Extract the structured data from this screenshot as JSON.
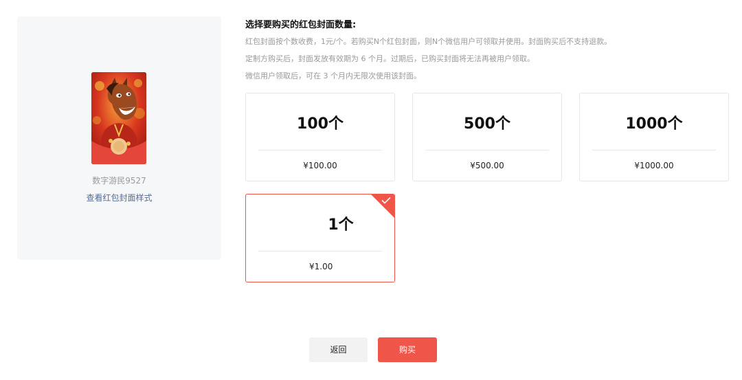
{
  "preview": {
    "name": "数字游民9527",
    "link_label": "查看红包封面样式"
  },
  "purchase": {
    "title": "选择要购买的红包封面数量:",
    "descriptions": [
      "红包封面按个数收费，1元/个。若购买N个红包封面，则N个微信用户可领取并使用。封面购买后不支持退款。",
      "定制方购买后，封面发放有效期为 6 个月。过期后，已购买封面将无法再被用户领取。",
      "微信用户领取后，可在 3 个月内无限次使用该封面。"
    ],
    "options": [
      {
        "quantity": "100个",
        "price": "¥100.00",
        "selected": false
      },
      {
        "quantity": "500个",
        "price": "¥500.00",
        "selected": false
      },
      {
        "quantity": "1000个",
        "price": "¥1000.00",
        "selected": false
      },
      {
        "quantity": "1个",
        "price": "¥1.00",
        "selected": true
      }
    ]
  },
  "actions": {
    "back_label": "返回",
    "buy_label": "购买"
  },
  "colors": {
    "accent": "#f0554a",
    "link": "#576b95",
    "panel_bg": "#f6f7f9"
  },
  "icons": {
    "selected_mark": "check-icon",
    "cover": "red-envelope-cover-image"
  }
}
